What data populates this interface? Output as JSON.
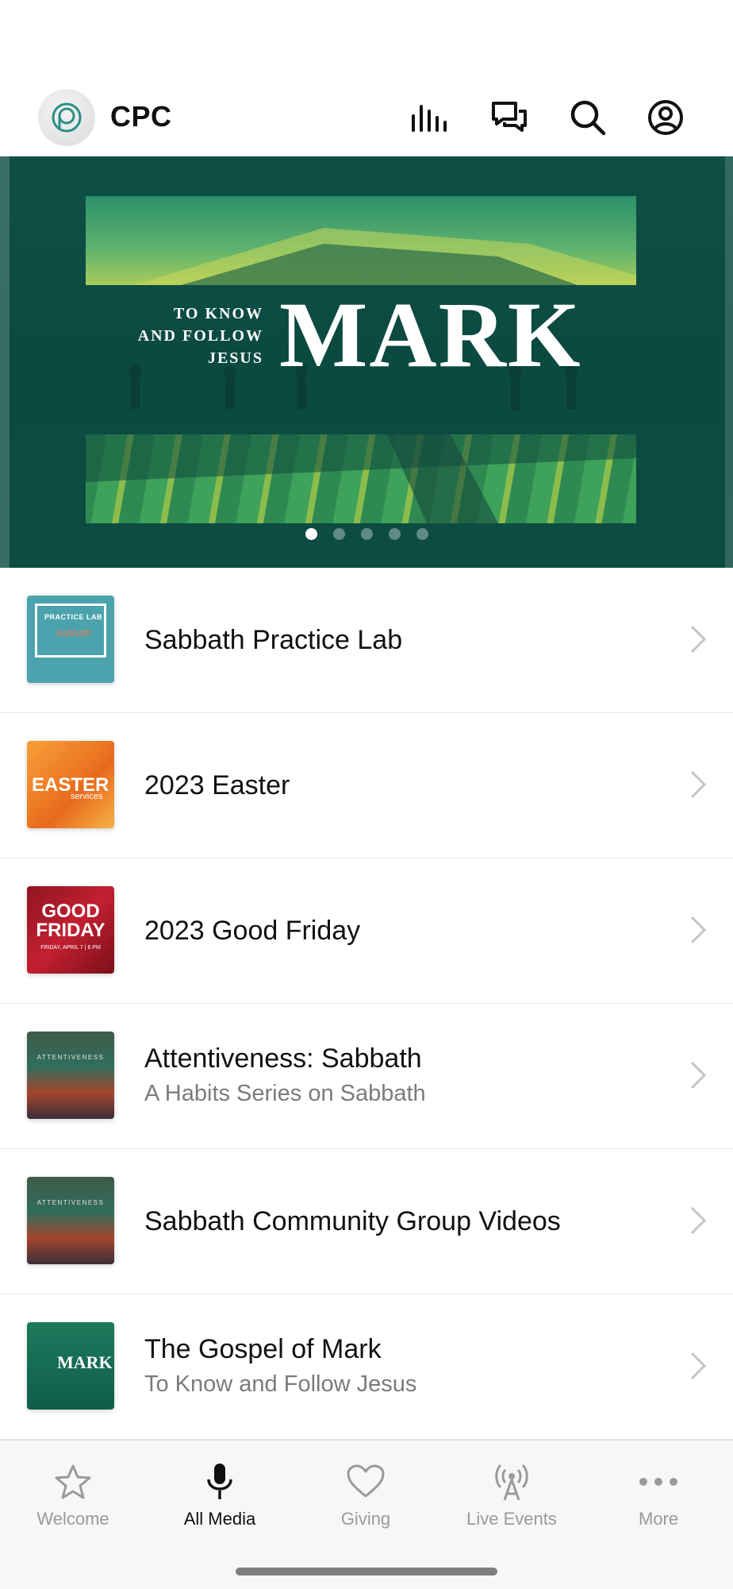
{
  "header": {
    "brand": "CPC",
    "icons": [
      "bars-icon",
      "chat-icon",
      "search-icon",
      "profile-icon"
    ]
  },
  "hero": {
    "tagline_lines": [
      "TO KNOW",
      "AND FOLLOW",
      "JESUS"
    ],
    "title": "MARK",
    "carousel": {
      "count": 5,
      "active": 0
    }
  },
  "list": [
    {
      "title": "Sabbath Practice Lab",
      "subtitle": "",
      "thumb_text": [
        "PRACTICE LAB",
        "Sabbath"
      ]
    },
    {
      "title": "2023 Easter",
      "subtitle": "",
      "thumb_text": [
        "EASTER",
        "services"
      ]
    },
    {
      "title": "2023 Good Friday",
      "subtitle": "",
      "thumb_text": [
        "GOOD FRIDAY",
        "FRIDAY, APRIL 7 | 6 PM"
      ]
    },
    {
      "title": "Attentiveness: Sabbath",
      "subtitle": "A Habits Series on Sabbath",
      "thumb_text": [
        "ATTENTIVENESS"
      ]
    },
    {
      "title": "Sabbath Community Group Videos",
      "subtitle": "",
      "thumb_text": [
        "ATTENTIVENESS"
      ]
    },
    {
      "title": "The Gospel of Mark",
      "subtitle": "To Know and Follow Jesus",
      "thumb_text": [
        "MARK"
      ]
    }
  ],
  "tabs": [
    {
      "label": "Welcome",
      "icon": "star-icon"
    },
    {
      "label": "All Media",
      "icon": "microphone-icon",
      "active": true
    },
    {
      "label": "Giving",
      "icon": "heart-icon"
    },
    {
      "label": "Live Events",
      "icon": "broadcast-icon"
    },
    {
      "label": "More",
      "icon": "more-icon"
    }
  ],
  "colors": {
    "hero_bg": "#0f4f45",
    "tab_inactive": "#9a9a9a",
    "tab_active": "#111111"
  }
}
